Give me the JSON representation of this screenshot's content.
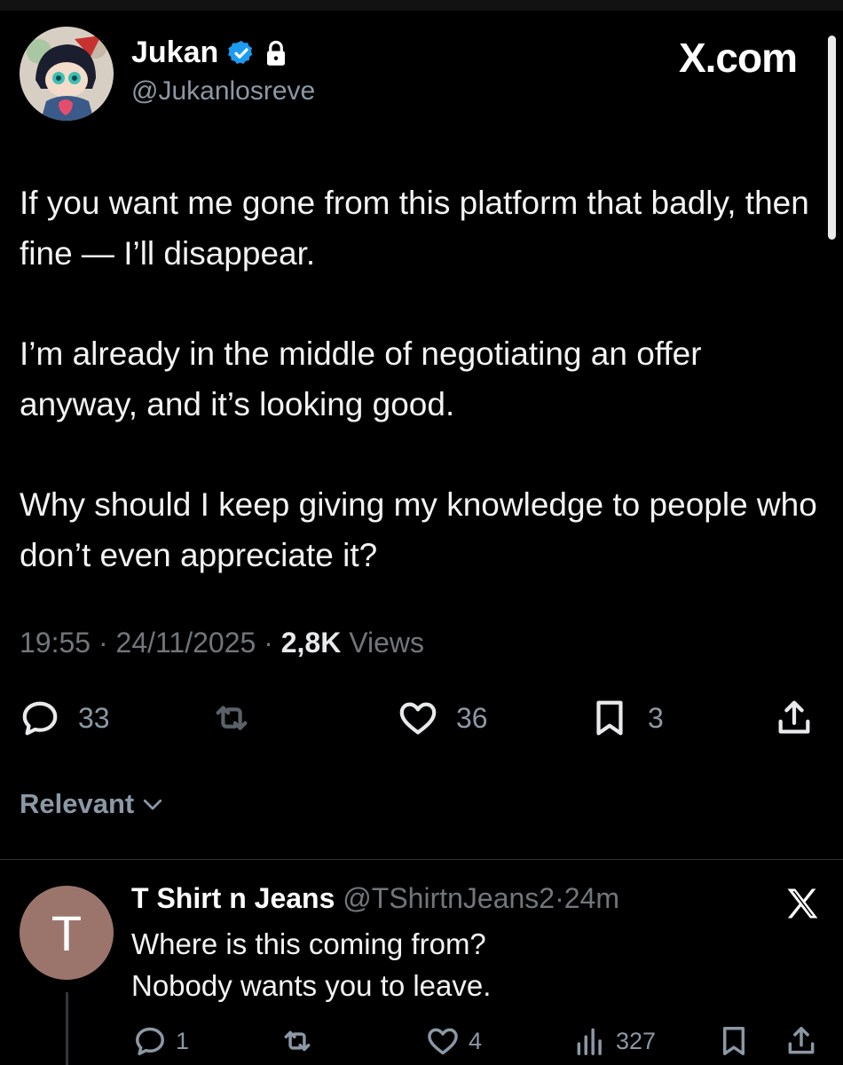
{
  "author": {
    "name": "Jukan",
    "handle": "@Jukanlosreve",
    "verified": true,
    "protected": true,
    "avatar_icon": "avatar-anime-character"
  },
  "brand": "X.com",
  "tweet": {
    "paragraphs": [
      "If you want me gone from this platform that badly, then fine — I’ll disappear.",
      "I’m already in the middle of negotiating an offer anyway, and it’s looking good.",
      "Why should I keep giving my knowledge to people who don’t even appreciate it?"
    ],
    "time": "19:55",
    "date": "24/11/2025",
    "views_count": "2,8K",
    "views_label": "Views",
    "separator": "·",
    "actions": {
      "replies": "33",
      "reposts": "",
      "likes": "36",
      "bookmarks": "3"
    }
  },
  "sort": {
    "label": "Relevant"
  },
  "reply": {
    "avatar_letter": "T",
    "name": "T Shirt n Jeans",
    "handle": "@TShirtnJeans2",
    "separator": "·",
    "time": "24m",
    "lines": [
      "Where is this coming from?",
      "Nobody wants you to leave."
    ],
    "actions": {
      "replies": "1",
      "reposts": "",
      "likes": "4",
      "views": "327"
    }
  },
  "colors": {
    "background": "#000000",
    "text": "#e7e9ea",
    "muted": "#71767b",
    "verified": "#1d9bf0",
    "reply_avatar": "#9b756c"
  }
}
